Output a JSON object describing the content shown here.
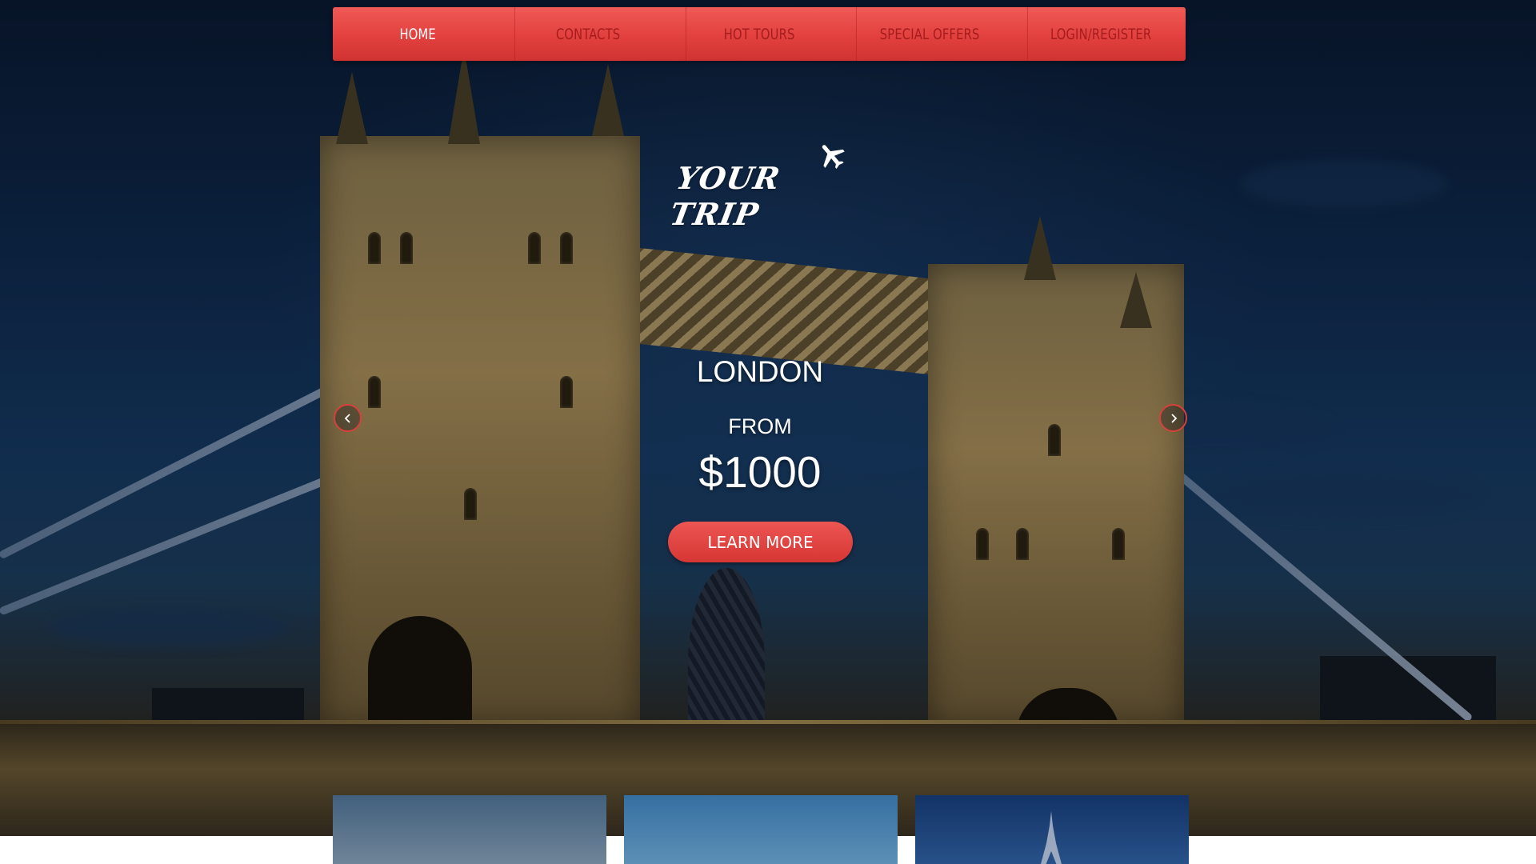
{
  "nav": {
    "items": [
      {
        "label": "HOME",
        "active": true
      },
      {
        "label": "CONTACTS",
        "active": false
      },
      {
        "label": "HOT TOURS",
        "active": false
      },
      {
        "label": "SPECIAL OFFERS",
        "active": false
      },
      {
        "label": "LOGIN/REGISTER",
        "active": false
      }
    ]
  },
  "logo": {
    "text": "YOUR TRIP",
    "icon": "airplane-icon"
  },
  "slide": {
    "city": "LONDON",
    "from_label": "FROM",
    "price": "$1000",
    "cta_label": "LEARN MORE"
  },
  "slider": {
    "prev_icon": "chevron-left-icon",
    "next_icon": "chevron-right-icon"
  },
  "colors": {
    "accent": "#e2403e",
    "nav_text": "#a51c1c",
    "active_text": "#ffffff"
  }
}
